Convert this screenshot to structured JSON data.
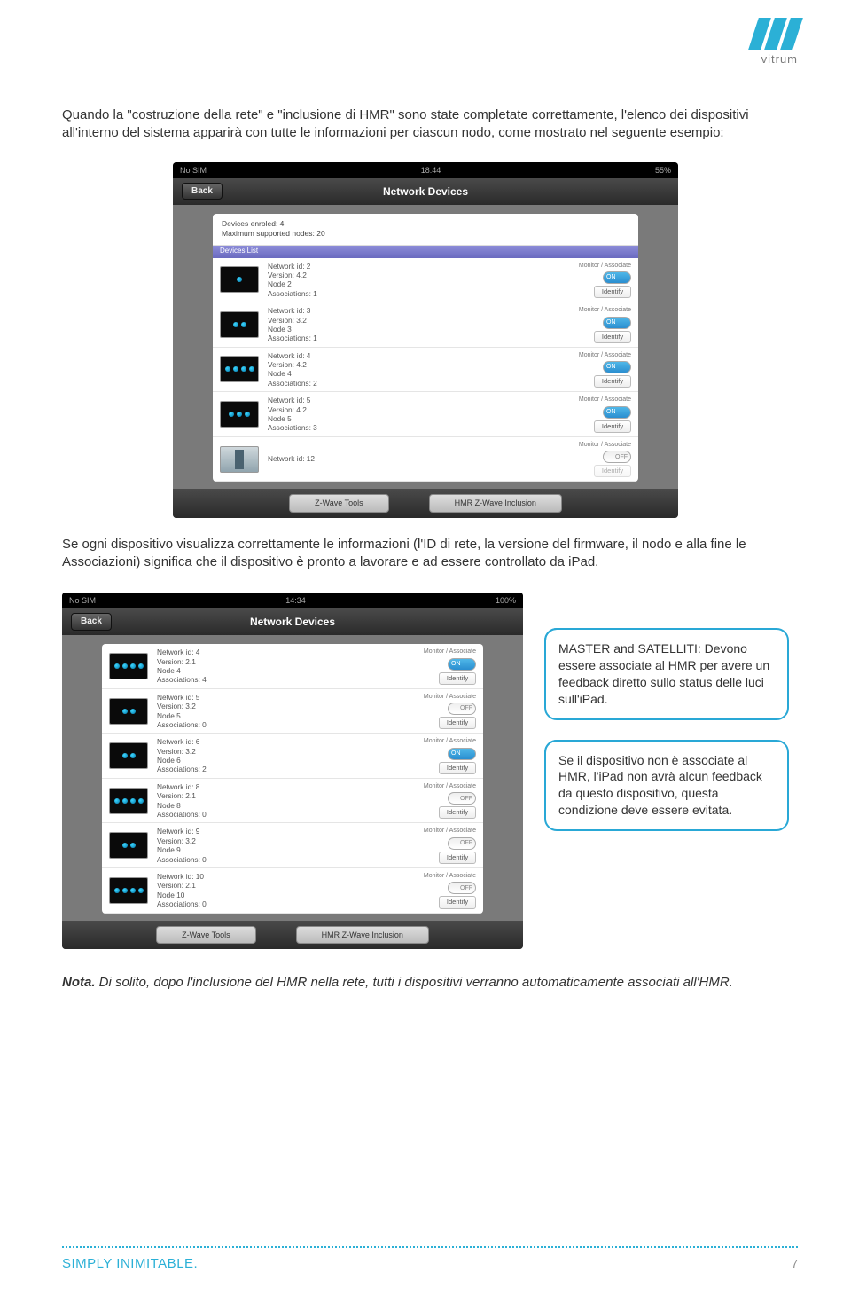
{
  "brand": "vitrum",
  "paragraphs": {
    "p1": "Quando la \"costruzione della rete\" e \"inclusione di HMR\" sono state completate correttamente, l'elenco dei dispositivi all'interno del sistema apparirà con tutte le informazioni per ciascun nodo, come mostrato nel seguente esempio:",
    "p2": "Se ogni dispositivo visualizza correttamente le informazioni (l'ID di rete, la versione del firmware, il nodo e alla fine le Associazioni) significa che il dispositivo è pronto a lavorare e ad essere controllato da iPad."
  },
  "callouts": {
    "c1": "MASTER and SATELLITI: Devono essere associate al HMR per avere un feedback diretto sullo status delle luci sull'iPad.",
    "c2": "Se il dispositivo non è associate al HMR, l'iPad non avrà alcun feedback da questo dispositivo, questa condizione deve essere evitata."
  },
  "note": {
    "label": "Nota.",
    "text": " Di solito, dopo l'inclusione del HMR nella rete, tutti i dispositivi verranno automaticamente associati all'HMR."
  },
  "footer": {
    "tagline": "SIMPLY INIMITABLE.",
    "page": "7"
  },
  "ipad_common": {
    "back": "Back",
    "title": "Network Devices",
    "monitor": "Monitor / Associate",
    "identify": "Identify",
    "on": "ON",
    "off": "OFF",
    "btn1": "Z-Wave Tools",
    "btn2": "HMR Z-Wave Inclusion",
    "carrier": "No SIM"
  },
  "shot1": {
    "time": "18:44",
    "battery": "55%",
    "info_enrolled": "Devices enroled: 4",
    "info_max": "Maximum supported nodes: 20",
    "section": "Devices List",
    "rows": [
      {
        "netid": 2,
        "ver": "4.2",
        "node": "Node 2",
        "assoc": 1,
        "on": true,
        "dots": 1,
        "gateway": false
      },
      {
        "netid": 3,
        "ver": "3.2",
        "node": "Node 3",
        "assoc": 1,
        "on": true,
        "dots": 2,
        "gateway": false
      },
      {
        "netid": 4,
        "ver": "4.2",
        "node": "Node 4",
        "assoc": 2,
        "on": true,
        "dots": 4,
        "gateway": false
      },
      {
        "netid": 5,
        "ver": "4.2",
        "node": "Node 5",
        "assoc": 3,
        "on": true,
        "dots": 3,
        "gateway": false
      },
      {
        "netid": 12,
        "ver": "",
        "node": "",
        "assoc": "",
        "on": false,
        "dots": 0,
        "gateway": true
      }
    ]
  },
  "shot2": {
    "time": "14:34",
    "battery": "100%",
    "rows": [
      {
        "netid": 4,
        "ver": "2.1",
        "node": "Node 4",
        "assoc": 4,
        "on": true,
        "dots": 4
      },
      {
        "netid": 5,
        "ver": "3.2",
        "node": "Node 5",
        "assoc": 0,
        "on": false,
        "dots": 2
      },
      {
        "netid": 6,
        "ver": "3.2",
        "node": "Node 6",
        "assoc": 2,
        "on": true,
        "dots": 2
      },
      {
        "netid": 8,
        "ver": "2.1",
        "node": "Node 8",
        "assoc": 0,
        "on": false,
        "dots": 4
      },
      {
        "netid": 9,
        "ver": "3.2",
        "node": "Node 9",
        "assoc": 0,
        "on": false,
        "dots": 2
      },
      {
        "netid": 10,
        "ver": "2.1",
        "node": "Node 10",
        "assoc": 0,
        "on": false,
        "dots": 4
      }
    ]
  }
}
